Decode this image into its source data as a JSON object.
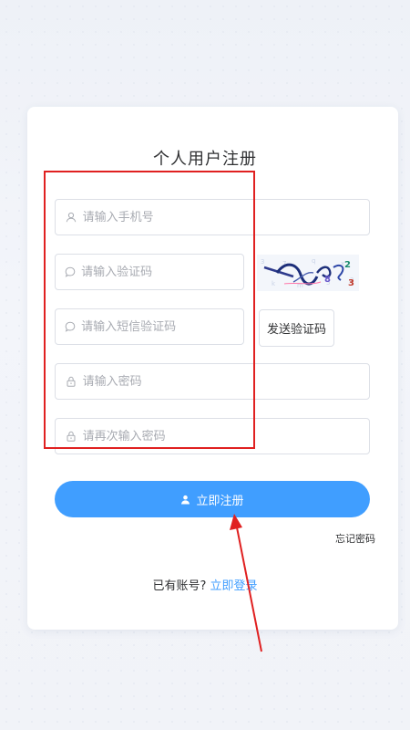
{
  "form": {
    "title": "个人用户注册",
    "phone_placeholder": "请输入手机号",
    "captcha_placeholder": "请输入验证码",
    "sms_placeholder": "请输入短信验证码",
    "password_placeholder": "请输入密码",
    "confirm_password_placeholder": "请再次输入密码",
    "send_code_label": "发送验证码",
    "register_label": "立即注册",
    "forgot_password_label": "忘记密码",
    "have_account_text": "已有账号?",
    "login_link": "立即登录"
  },
  "icons": {
    "phone": "user-icon",
    "captcha": "chat-bubble-icon",
    "sms": "chat-bubble-icon",
    "password": "lock-icon",
    "confirm_password": "lock-icon",
    "register": "user-icon"
  },
  "colors": {
    "primary": "#409eff",
    "annotation": "#e02020",
    "text": "#303133",
    "placeholder": "#a8abb2",
    "border": "#dcdfe6"
  }
}
